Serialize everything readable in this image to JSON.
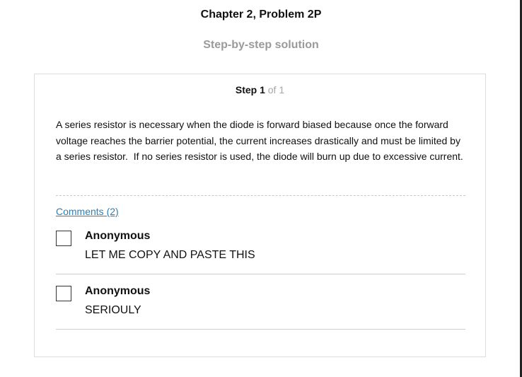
{
  "header": {
    "title": "Chapter 2, Problem 2P",
    "subtitle": "Step-by-step solution"
  },
  "step": {
    "label": "Step 1",
    "of": " of 1",
    "body": "A series resistor is necessary when the diode is forward biased because once the forward voltage reaches the barrier potential, the current increases drastically and must be limited by a series resistor.  If no series resistor is used, the diode will burn up due to excessive current."
  },
  "comments": {
    "link_label": "Comments (2)",
    "items": [
      {
        "author": "Anonymous",
        "text": "LET ME COPY AND PASTE THIS"
      },
      {
        "author": "Anonymous",
        "text": "SERIOULY"
      }
    ]
  },
  "colors": {
    "link": "#2f7fb3",
    "muted": "#9a9a9a"
  }
}
